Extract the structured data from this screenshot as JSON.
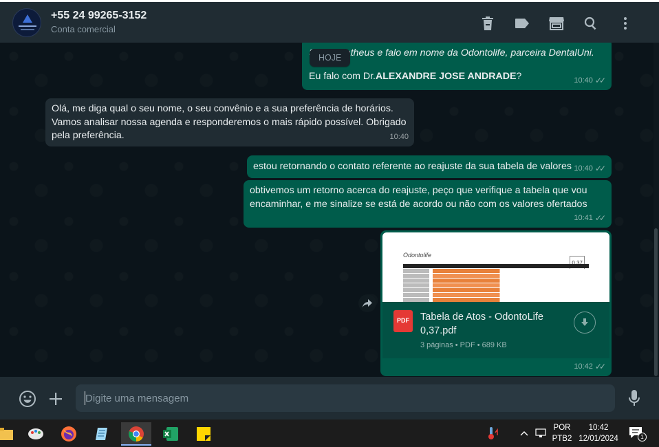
{
  "header": {
    "contact_name": "+55 24 99265-3152",
    "contact_subtitle": "Conta comercial",
    "icons": [
      "delete-icon",
      "label-icon",
      "store-icon",
      "search-icon",
      "menu-icon"
    ]
  },
  "chat": {
    "date_chip": "HOJE",
    "messages": [
      {
        "direction": "out",
        "line1": "Sou o Matheus e falo em nome da Odontolife, parceira DentalUni.",
        "line2_prefix": "Eu falo com Dr.",
        "line2_bold": "ALEXANDRE JOSE ANDRADE",
        "line2_suffix": "?",
        "time": "10:40",
        "status": "read"
      },
      {
        "direction": "in",
        "text": "Olá, me diga qual o seu nome, o seu convênio e a sua preferência de horários. Vamos analisar nossa agenda e responderemos o mais rápido possível. Obrigado pela preferência.",
        "time": "10:40"
      },
      {
        "direction": "out",
        "text": "estou retornando o contato referente ao reajuste da sua tabela de valores",
        "time": "10:40",
        "status": "read"
      },
      {
        "direction": "out",
        "text": "obtivemos um retorno acerca do reajuste, peço que verifique a tabela que vou encaminhar, e me sinalize se está de acordo ou não com os valores ofertados",
        "time": "10:41",
        "status": "read"
      },
      {
        "direction": "out",
        "type": "document",
        "file_badge": "PDF",
        "file_name": "Tabela de Atos - OdontoLife 0,37.pdf",
        "file_meta": "3 páginas • PDF • 689 KB",
        "preview_logo": "Odontolife",
        "preview_number": "0,37",
        "time": "10:42",
        "status": "read"
      }
    ]
  },
  "composer": {
    "placeholder": "Digite uma mensagem"
  },
  "taskbar": {
    "apps": [
      "file-explorer-icon",
      "paint-icon",
      "firefox-icon",
      "notepad-icon",
      "chrome-icon",
      "excel-icon",
      "sticky-notes-icon"
    ],
    "active_app": "chrome-icon",
    "language_line1": "POR",
    "language_line2": "PTB2",
    "time": "10:42",
    "date": "12/01/2024",
    "notification_count": "1"
  },
  "colors": {
    "outgoing_bubble": "#005c4b",
    "incoming_bubble": "#202c33",
    "header_bg": "#202c33",
    "chat_bg": "#0b141a",
    "tick_color": "#8696a0"
  }
}
